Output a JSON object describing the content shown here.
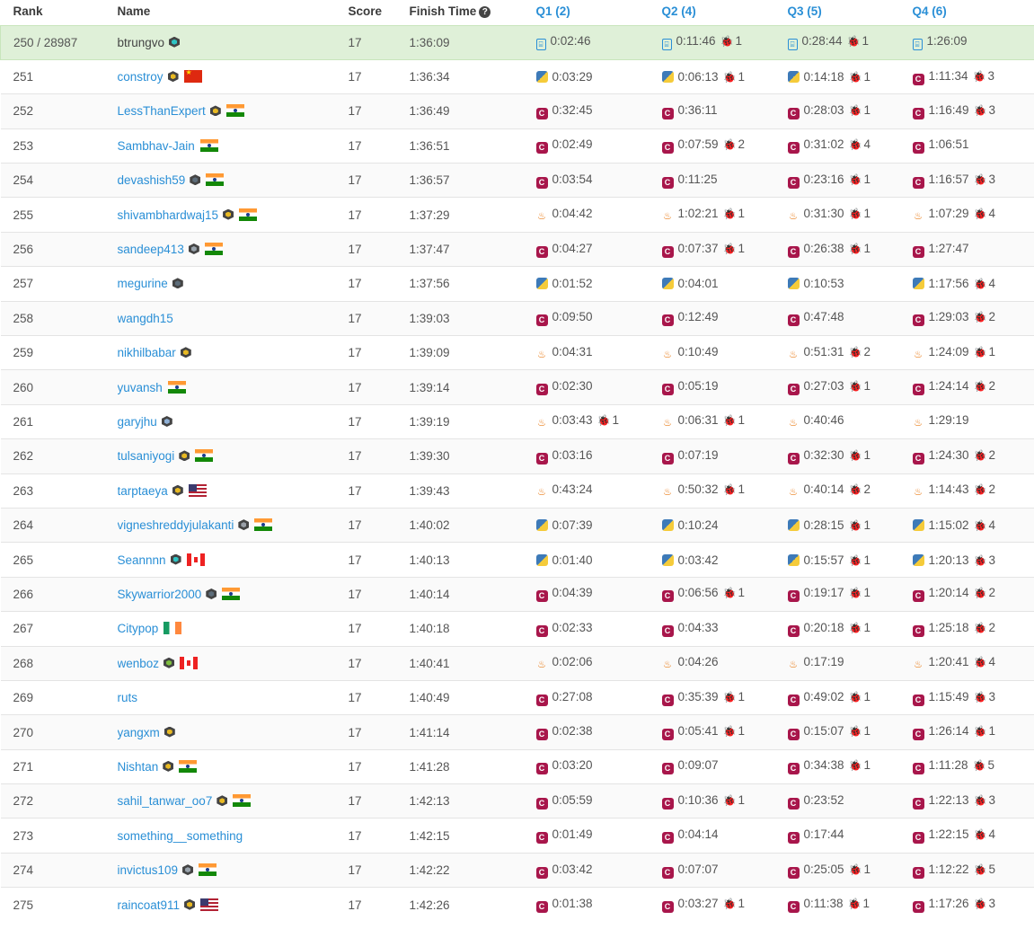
{
  "headers": {
    "rank": "Rank",
    "name": "Name",
    "score": "Score",
    "finish": "Finish Time",
    "q1": "Q1 (2)",
    "q2": "Q2 (4)",
    "q3": "Q3 (5)",
    "q4": "Q4 (6)"
  },
  "colors": {
    "link": "#2a8fd6",
    "highlight_row": "#dff0d8",
    "bug": "#c9302c"
  },
  "rows": [
    {
      "rank": "250 / 28987",
      "name": "btrungvo",
      "badge": "teal",
      "flag": "",
      "score": "17",
      "finish": "1:36:09",
      "self": true,
      "q": [
        {
          "lang": "doc",
          "t": "0:02:46",
          "w": ""
        },
        {
          "lang": "doc",
          "t": "0:11:46",
          "w": "1"
        },
        {
          "lang": "doc",
          "t": "0:28:44",
          "w": "1"
        },
        {
          "lang": "doc",
          "t": "1:26:09",
          "w": ""
        }
      ]
    },
    {
      "rank": "251",
      "name": "constroy",
      "badge": "gold",
      "flag": "cn",
      "score": "17",
      "finish": "1:36:34",
      "q": [
        {
          "lang": "py",
          "t": "0:03:29",
          "w": ""
        },
        {
          "lang": "py",
          "t": "0:06:13",
          "w": "1"
        },
        {
          "lang": "py",
          "t": "0:14:18",
          "w": "1"
        },
        {
          "lang": "c",
          "t": "1:11:34",
          "w": "3"
        }
      ]
    },
    {
      "rank": "252",
      "name": "LessThanExpert",
      "badge": "gold",
      "flag": "in",
      "score": "17",
      "finish": "1:36:49",
      "q": [
        {
          "lang": "c",
          "t": "0:32:45",
          "w": ""
        },
        {
          "lang": "c",
          "t": "0:36:11",
          "w": ""
        },
        {
          "lang": "c",
          "t": "0:28:03",
          "w": "1"
        },
        {
          "lang": "c",
          "t": "1:16:49",
          "w": "3"
        }
      ]
    },
    {
      "rank": "253",
      "name": "Sambhav-Jain",
      "badge": "",
      "flag": "in",
      "score": "17",
      "finish": "1:36:51",
      "q": [
        {
          "lang": "c",
          "t": "0:02:49",
          "w": ""
        },
        {
          "lang": "c",
          "t": "0:07:59",
          "w": "2"
        },
        {
          "lang": "c",
          "t": "0:31:02",
          "w": "4"
        },
        {
          "lang": "c",
          "t": "1:06:51",
          "w": ""
        }
      ]
    },
    {
      "rank": "254",
      "name": "devashish59",
      "badge": "dark",
      "flag": "in",
      "score": "17",
      "finish": "1:36:57",
      "q": [
        {
          "lang": "c",
          "t": "0:03:54",
          "w": ""
        },
        {
          "lang": "c",
          "t": "0:11:25",
          "w": ""
        },
        {
          "lang": "c",
          "t": "0:23:16",
          "w": "1"
        },
        {
          "lang": "c",
          "t": "1:16:57",
          "w": "3"
        }
      ]
    },
    {
      "rank": "255",
      "name": "shivambhardwaj15",
      "badge": "gold",
      "flag": "in",
      "score": "17",
      "finish": "1:37:29",
      "q": [
        {
          "lang": "java",
          "t": "0:04:42",
          "w": ""
        },
        {
          "lang": "java",
          "t": "1:02:21",
          "w": "1"
        },
        {
          "lang": "java",
          "t": "0:31:30",
          "w": "1"
        },
        {
          "lang": "java",
          "t": "1:07:29",
          "w": "4"
        }
      ]
    },
    {
      "rank": "256",
      "name": "sandeep413",
      "badge": "none",
      "flag": "in",
      "score": "17",
      "finish": "1:37:47",
      "q": [
        {
          "lang": "c",
          "t": "0:04:27",
          "w": ""
        },
        {
          "lang": "c",
          "t": "0:07:37",
          "w": "1"
        },
        {
          "lang": "c",
          "t": "0:26:38",
          "w": "1"
        },
        {
          "lang": "c",
          "t": "1:27:47",
          "w": ""
        }
      ]
    },
    {
      "rank": "257",
      "name": "megurine",
      "badge": "dark",
      "flag": "",
      "score": "17",
      "finish": "1:37:56",
      "q": [
        {
          "lang": "py",
          "t": "0:01:52",
          "w": ""
        },
        {
          "lang": "py",
          "t": "0:04:01",
          "w": ""
        },
        {
          "lang": "py",
          "t": "0:10:53",
          "w": ""
        },
        {
          "lang": "py",
          "t": "1:17:56",
          "w": "4"
        }
      ]
    },
    {
      "rank": "258",
      "name": "wangdh15",
      "badge": "",
      "flag": "",
      "score": "17",
      "finish": "1:39:03",
      "q": [
        {
          "lang": "c",
          "t": "0:09:50",
          "w": ""
        },
        {
          "lang": "c",
          "t": "0:12:49",
          "w": ""
        },
        {
          "lang": "c",
          "t": "0:47:48",
          "w": ""
        },
        {
          "lang": "c",
          "t": "1:29:03",
          "w": "2"
        }
      ]
    },
    {
      "rank": "259",
      "name": "nikhilbabar",
      "badge": "gold",
      "flag": "",
      "score": "17",
      "finish": "1:39:09",
      "q": [
        {
          "lang": "java",
          "t": "0:04:31",
          "w": ""
        },
        {
          "lang": "java",
          "t": "0:10:49",
          "w": ""
        },
        {
          "lang": "java",
          "t": "0:51:31",
          "w": "2"
        },
        {
          "lang": "java",
          "t": "1:24:09",
          "w": "1"
        }
      ]
    },
    {
      "rank": "260",
      "name": "yuvansh",
      "badge": "",
      "flag": "in",
      "score": "17",
      "finish": "1:39:14",
      "q": [
        {
          "lang": "c",
          "t": "0:02:30",
          "w": ""
        },
        {
          "lang": "c",
          "t": "0:05:19",
          "w": ""
        },
        {
          "lang": "c",
          "t": "0:27:03",
          "w": "1"
        },
        {
          "lang": "c",
          "t": "1:24:14",
          "w": "2"
        }
      ]
    },
    {
      "rank": "261",
      "name": "garyjhu",
      "badge": "lightblue",
      "flag": "",
      "score": "17",
      "finish": "1:39:19",
      "q": [
        {
          "lang": "java",
          "t": "0:03:43",
          "w": "1"
        },
        {
          "lang": "java",
          "t": "0:06:31",
          "w": "1"
        },
        {
          "lang": "java",
          "t": "0:40:46",
          "w": ""
        },
        {
          "lang": "java",
          "t": "1:29:19",
          "w": ""
        }
      ]
    },
    {
      "rank": "262",
      "name": "tulsaniyogi",
      "badge": "gold",
      "flag": "in",
      "score": "17",
      "finish": "1:39:30",
      "q": [
        {
          "lang": "c",
          "t": "0:03:16",
          "w": ""
        },
        {
          "lang": "c",
          "t": "0:07:19",
          "w": ""
        },
        {
          "lang": "c",
          "t": "0:32:30",
          "w": "1"
        },
        {
          "lang": "c",
          "t": "1:24:30",
          "w": "2"
        }
      ]
    },
    {
      "rank": "263",
      "name": "tarptaeya",
      "badge": "gold",
      "flag": "us",
      "score": "17",
      "finish": "1:39:43",
      "q": [
        {
          "lang": "java",
          "t": "0:43:24",
          "w": ""
        },
        {
          "lang": "java",
          "t": "0:50:32",
          "w": "1"
        },
        {
          "lang": "java",
          "t": "0:40:14",
          "w": "2"
        },
        {
          "lang": "java",
          "t": "1:14:43",
          "w": "2"
        }
      ]
    },
    {
      "rank": "264",
      "name": "vigneshreddyjulakanti",
      "badge": "grey",
      "flag": "in",
      "score": "17",
      "finish": "1:40:02",
      "q": [
        {
          "lang": "py",
          "t": "0:07:39",
          "w": ""
        },
        {
          "lang": "py",
          "t": "0:10:24",
          "w": ""
        },
        {
          "lang": "py",
          "t": "0:28:15",
          "w": "1"
        },
        {
          "lang": "py",
          "t": "1:15:02",
          "w": "4"
        }
      ]
    },
    {
      "rank": "265",
      "name": "Seannnn",
      "badge": "teal",
      "flag": "ca",
      "score": "17",
      "finish": "1:40:13",
      "q": [
        {
          "lang": "py",
          "t": "0:01:40",
          "w": ""
        },
        {
          "lang": "py",
          "t": "0:03:42",
          "w": ""
        },
        {
          "lang": "py",
          "t": "0:15:57",
          "w": "1"
        },
        {
          "lang": "py",
          "t": "1:20:13",
          "w": "3"
        }
      ]
    },
    {
      "rank": "266",
      "name": "Skywarrior2000",
      "badge": "dark",
      "flag": "in",
      "score": "17",
      "finish": "1:40:14",
      "q": [
        {
          "lang": "c",
          "t": "0:04:39",
          "w": ""
        },
        {
          "lang": "c",
          "t": "0:06:56",
          "w": "1"
        },
        {
          "lang": "c",
          "t": "0:19:17",
          "w": "1"
        },
        {
          "lang": "c",
          "t": "1:20:14",
          "w": "2"
        }
      ]
    },
    {
      "rank": "267",
      "name": "Citypop",
      "badge": "",
      "flag": "ie",
      "score": "17",
      "finish": "1:40:18",
      "q": [
        {
          "lang": "c",
          "t": "0:02:33",
          "w": ""
        },
        {
          "lang": "c",
          "t": "0:04:33",
          "w": ""
        },
        {
          "lang": "c",
          "t": "0:20:18",
          "w": "1"
        },
        {
          "lang": "c",
          "t": "1:25:18",
          "w": "2"
        }
      ]
    },
    {
      "rank": "268",
      "name": "wenboz",
      "badge": "green",
      "flag": "ca",
      "score": "17",
      "finish": "1:40:41",
      "q": [
        {
          "lang": "java",
          "t": "0:02:06",
          "w": ""
        },
        {
          "lang": "java",
          "t": "0:04:26",
          "w": ""
        },
        {
          "lang": "java",
          "t": "0:17:19",
          "w": ""
        },
        {
          "lang": "java",
          "t": "1:20:41",
          "w": "4"
        }
      ]
    },
    {
      "rank": "269",
      "name": "ruts",
      "badge": "",
      "flag": "",
      "score": "17",
      "finish": "1:40:49",
      "q": [
        {
          "lang": "c",
          "t": "0:27:08",
          "w": ""
        },
        {
          "lang": "c",
          "t": "0:35:39",
          "w": "1"
        },
        {
          "lang": "c",
          "t": "0:49:02",
          "w": "1"
        },
        {
          "lang": "c",
          "t": "1:15:49",
          "w": "3"
        }
      ]
    },
    {
      "rank": "270",
      "name": "yangxm",
      "badge": "gold",
      "flag": "",
      "score": "17",
      "finish": "1:41:14",
      "q": [
        {
          "lang": "c",
          "t": "0:02:38",
          "w": ""
        },
        {
          "lang": "c",
          "t": "0:05:41",
          "w": "1"
        },
        {
          "lang": "c",
          "t": "0:15:07",
          "w": "1"
        },
        {
          "lang": "c",
          "t": "1:26:14",
          "w": "1"
        }
      ]
    },
    {
      "rank": "271",
      "name": "Nishtan",
      "badge": "gold",
      "flag": "in",
      "score": "17",
      "finish": "1:41:28",
      "q": [
        {
          "lang": "c",
          "t": "0:03:20",
          "w": ""
        },
        {
          "lang": "c",
          "t": "0:09:07",
          "w": ""
        },
        {
          "lang": "c",
          "t": "0:34:38",
          "w": "1"
        },
        {
          "lang": "c",
          "t": "1:11:28",
          "w": "5"
        }
      ]
    },
    {
      "rank": "272",
      "name": "sahil_tanwar_oo7",
      "badge": "gold",
      "flag": "in",
      "score": "17",
      "finish": "1:42:13",
      "q": [
        {
          "lang": "c",
          "t": "0:05:59",
          "w": ""
        },
        {
          "lang": "c",
          "t": "0:10:36",
          "w": "1"
        },
        {
          "lang": "c",
          "t": "0:23:52",
          "w": ""
        },
        {
          "lang": "c",
          "t": "1:22:13",
          "w": "3"
        }
      ]
    },
    {
      "rank": "273",
      "name": "something__something",
      "badge": "",
      "flag": "",
      "score": "17",
      "finish": "1:42:15",
      "q": [
        {
          "lang": "c",
          "t": "0:01:49",
          "w": ""
        },
        {
          "lang": "c",
          "t": "0:04:14",
          "w": ""
        },
        {
          "lang": "c",
          "t": "0:17:44",
          "w": ""
        },
        {
          "lang": "c",
          "t": "1:22:15",
          "w": "4"
        }
      ]
    },
    {
      "rank": "274",
      "name": "invictus109",
      "badge": "none",
      "flag": "in",
      "score": "17",
      "finish": "1:42:22",
      "q": [
        {
          "lang": "c",
          "t": "0:03:42",
          "w": ""
        },
        {
          "lang": "c",
          "t": "0:07:07",
          "w": ""
        },
        {
          "lang": "c",
          "t": "0:25:05",
          "w": "1"
        },
        {
          "lang": "c",
          "t": "1:12:22",
          "w": "5"
        }
      ]
    },
    {
      "rank": "275",
      "name": "raincoat911",
      "badge": "gold",
      "flag": "us",
      "score": "17",
      "finish": "1:42:26",
      "q": [
        {
          "lang": "c",
          "t": "0:01:38",
          "w": ""
        },
        {
          "lang": "c",
          "t": "0:03:27",
          "w": "1"
        },
        {
          "lang": "c",
          "t": "0:11:38",
          "w": "1"
        },
        {
          "lang": "c",
          "t": "1:17:26",
          "w": "3"
        }
      ]
    }
  ]
}
